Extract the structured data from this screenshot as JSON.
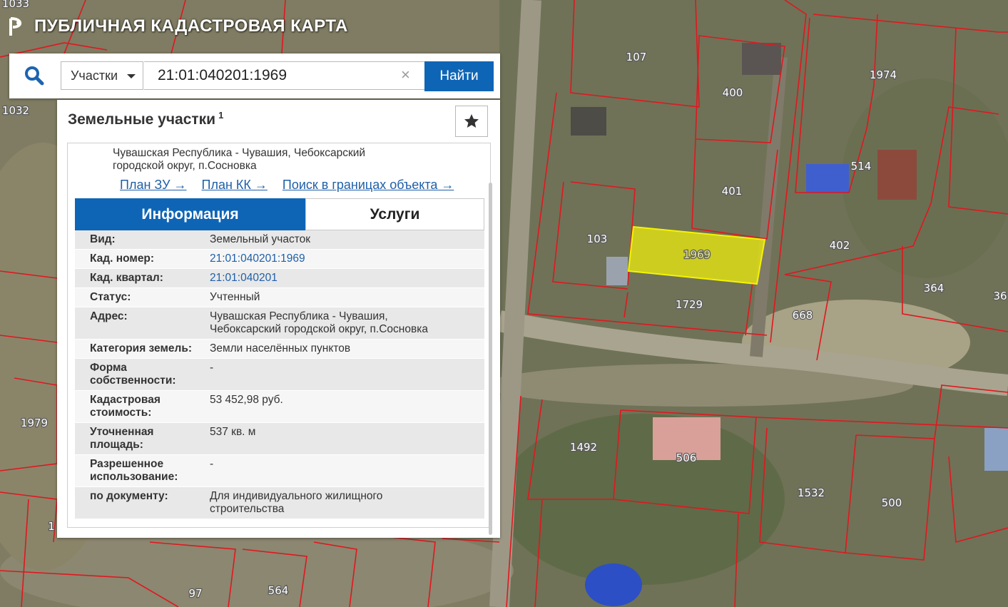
{
  "app": {
    "title": "ПУБЛИЧНАЯ КАДАСТРОВАЯ КАРТА"
  },
  "search": {
    "type_selected": "Участки",
    "query": "21:01:040201:1969",
    "clear_icon": "close-icon",
    "submit_label": "Найти"
  },
  "panel": {
    "title": "Земельные участки",
    "count": "1",
    "favorite_icon": "star-icon",
    "address_line1": "Чувашская Республика - Чувашия, Чебоксарский",
    "address_line2": "городской округ, п.Сосновка",
    "links": {
      "plan_zu": "План ЗУ →",
      "plan_kk": "План КК →",
      "search_in_bounds": "Поиск в границах объекта →"
    },
    "tabs": {
      "info": "Информация",
      "services": "Услуги"
    },
    "properties": [
      {
        "key": "Вид:",
        "value": "Земельный участок"
      },
      {
        "key": "Кад. номер:",
        "value": "21:01:040201:1969"
      },
      {
        "key": "Кад. квартал:",
        "value": "21:01:040201"
      },
      {
        "key": "Статус:",
        "value": "Учтенный"
      },
      {
        "key": "Адрес:",
        "value": "Чувашская Республика - Чувашия,",
        "value2": "Чебоксарский городской округ, п.Сосновка"
      },
      {
        "key": "Категория земель:",
        "value": "Земли населённых пунктов"
      },
      {
        "key": "Форма",
        "key2": "собственности:",
        "value": "-"
      },
      {
        "key": "Кадастровая",
        "key2": "стоимость:",
        "value": "53 452,98 руб."
      },
      {
        "key": "Уточненная",
        "key2": "площадь:",
        "value": "537 кв. м"
      },
      {
        "key": "Разрешенное",
        "key2": "использование:",
        "value": "-"
      },
      {
        "key": "по документу:",
        "value": "Для индивидуального жилищного",
        "value2": "строительства"
      }
    ]
  },
  "map": {
    "plot_labels": [
      "1033",
      "1032",
      "107",
      "400",
      "1974",
      "514",
      "401",
      "103",
      "1969",
      "402",
      "1729",
      "668",
      "364",
      "36",
      "1979",
      "1492",
      "506",
      "1532",
      "500",
      "97",
      "564",
      "1"
    ],
    "colors": {
      "boundary": "#e0171f",
      "selected_fill": "#ecec0e",
      "accent": "#0f65b5"
    }
  }
}
